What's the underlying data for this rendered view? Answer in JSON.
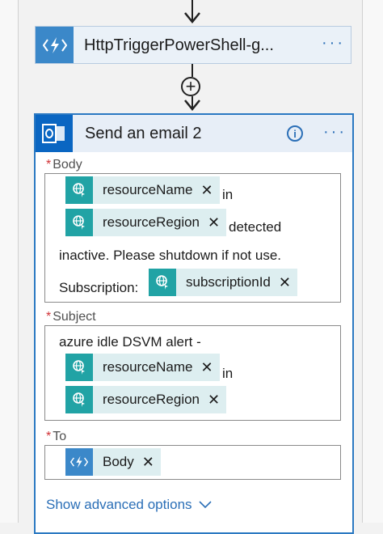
{
  "trigger": {
    "title": "HttpTriggerPowerShell-g...",
    "more": "···",
    "icon": "lightning-icon"
  },
  "add_step": {
    "symbol": "+"
  },
  "action": {
    "title": "Send an email 2",
    "info": "i",
    "more": "···",
    "icon": "outlook-icon"
  },
  "fields": {
    "required_mark": "*",
    "body": {
      "label": "Body",
      "token1": "resourceName",
      "text1": "in",
      "token2": "resourceRegion",
      "text2": "detected",
      "text3": "inactive. Please shutdown if not use.",
      "text4": "Subscription:",
      "token3": "subscriptionId"
    },
    "subject": {
      "label": "Subject",
      "text1": "azure idle DSVM alert -",
      "token1": "resourceName",
      "text2": "in",
      "token2": "resourceRegion"
    },
    "to": {
      "label": "To",
      "token1": "Body"
    }
  },
  "token_remove": "✕",
  "advanced_label": "Show advanced options",
  "colors": {
    "accent": "#2b79c2",
    "token_bg": "#ddeef0",
    "token_icon": "#21a3a5",
    "required": "#d13438"
  }
}
